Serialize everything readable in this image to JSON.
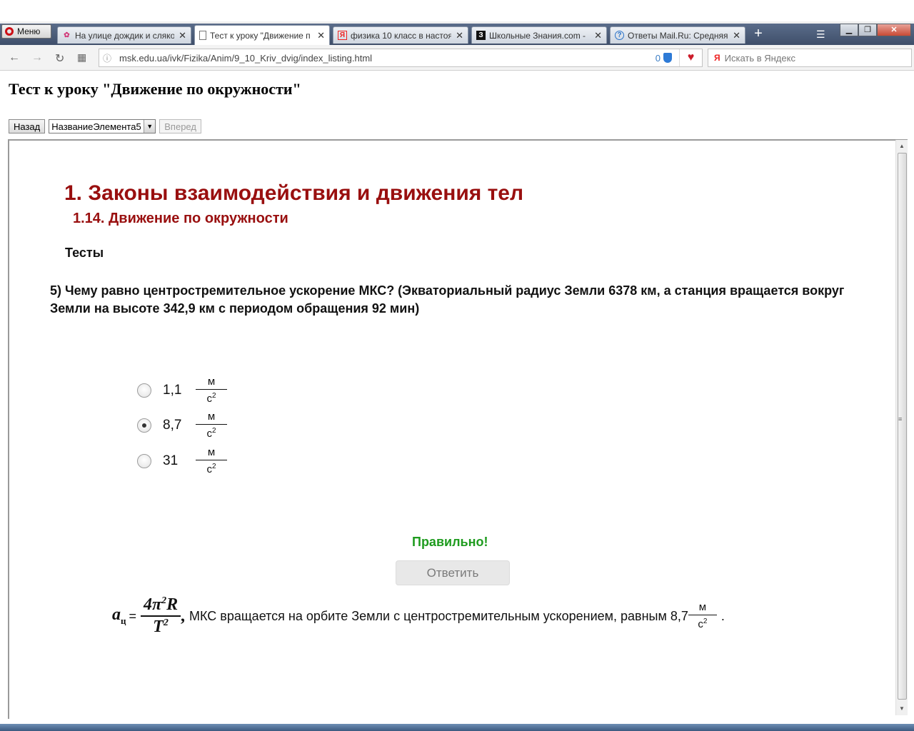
{
  "browser": {
    "menu_label": "Меню",
    "tabs": [
      {
        "label": "На улице дождик и сляко"
      },
      {
        "label": "Тест к уроку \"Движение п"
      },
      {
        "label": "физика 10 класс в настоя"
      },
      {
        "label": "Школьные Знания.com -"
      },
      {
        "label": "Ответы Mail.Ru: Средняя"
      }
    ],
    "new_tab_symbol": "+",
    "url": "msk.edu.ua/ivk/Fizika/Anim/9_10_Kriv_dvig/index_listing.html",
    "url_badge_count": "0",
    "search_placeholder": "Искать в Яндекс"
  },
  "page": {
    "title": "Тест к уроку \"Движение по окружности\"",
    "nav": {
      "back_label": "Назад",
      "select_value": "НазваниеЭлемента5",
      "forward_label": "Вперед"
    }
  },
  "content": {
    "heading": "1. Законы взаимодействия и движения тел",
    "subheading": "1.14. Движение по окружности",
    "section": "Тесты",
    "question": "5) Чему равно центростремительное ускорение МКС? (Экваториальный радиус Земли 6378 км, а станция вращается вокруг Земли на высоте 342,9 км с периодом обращения 92 мин)",
    "unit_num": "м",
    "unit_den": "с",
    "unit_exp": "2",
    "options": [
      {
        "value": "1,1",
        "selected": false
      },
      {
        "value": "8,7",
        "selected": true
      },
      {
        "value": "31",
        "selected": false
      }
    ],
    "feedback": "Правильно!",
    "answer_button": "Ответить",
    "explanation": {
      "lhs": "a",
      "lhs_sub": "ц",
      "eq": "=",
      "num": "4π",
      "num_exp": "2",
      "num_tail": "R",
      "den": "T",
      "den_exp": "2",
      "comma": ",",
      "text": "МКС вращается на орбите Земли с центростремительным ускорением, равным 8,7",
      "end": "."
    }
  }
}
